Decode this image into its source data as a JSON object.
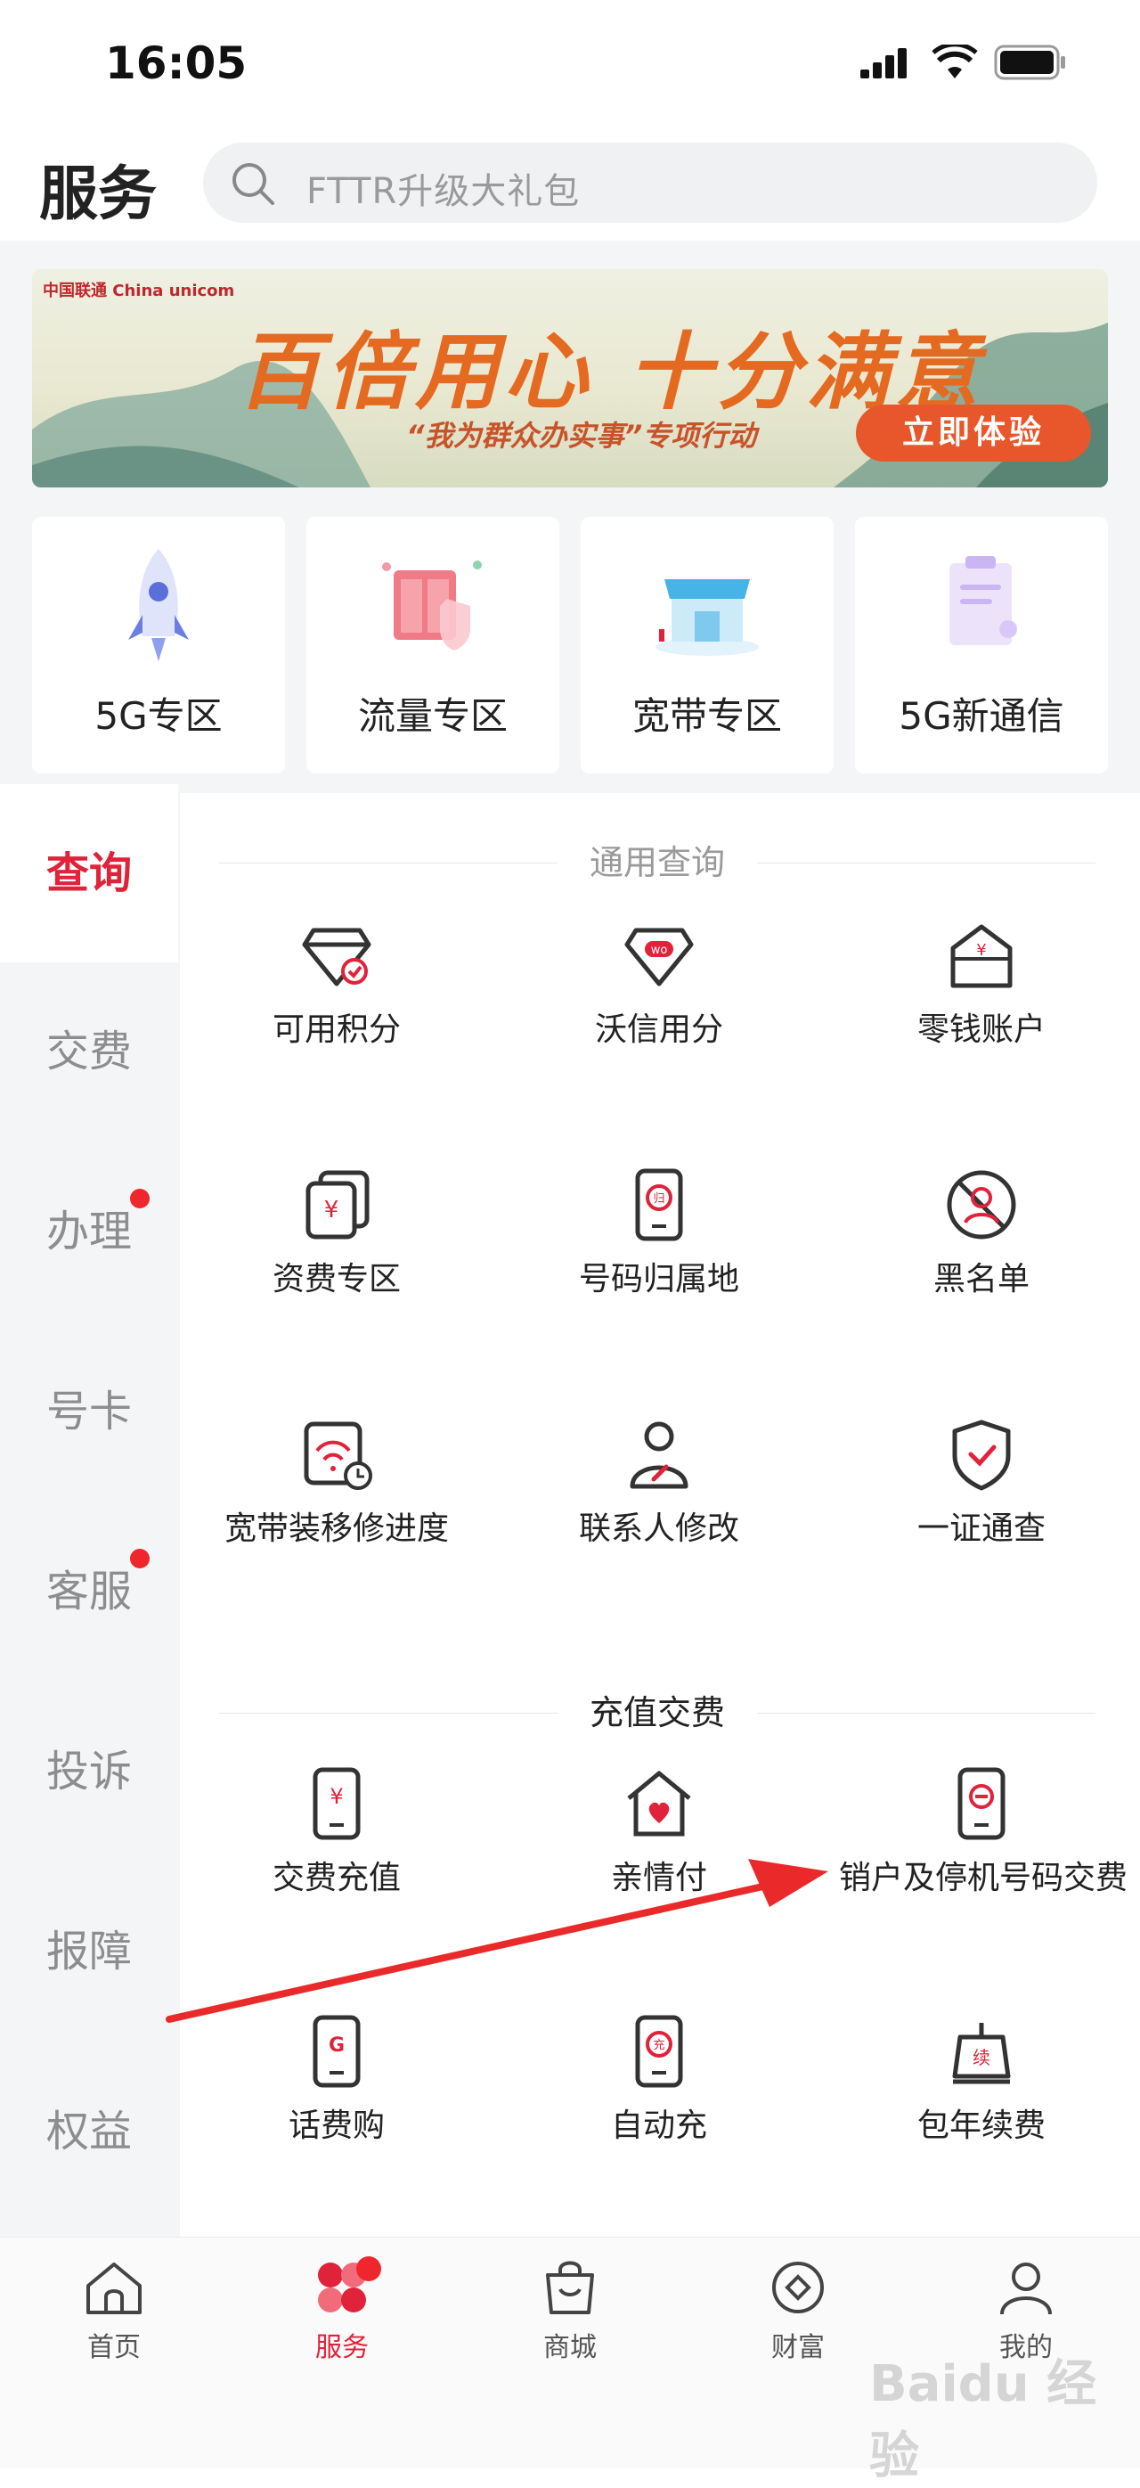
{
  "status_bar": {
    "time": "16:05"
  },
  "header": {
    "title": "服务",
    "search_placeholder": "FTTR升级大礼包"
  },
  "banner": {
    "brand": "中国联通 China unicom",
    "title": "百倍用心 十分满意",
    "subtitle": "“我为群众办实事”专项行动",
    "cta": "立即体验"
  },
  "zones": [
    {
      "label": "5G专区",
      "icon": "rocket-icon"
    },
    {
      "label": "流量专区",
      "icon": "shield-door-icon"
    },
    {
      "label": "宽带专区",
      "icon": "store-icon"
    },
    {
      "label": "5G新通信",
      "icon": "clipboard-icon"
    }
  ],
  "sidebar": {
    "items": [
      {
        "label": "查询",
        "active": true
      },
      {
        "label": "交费"
      },
      {
        "label": "办理",
        "badge": true
      },
      {
        "label": "号卡"
      },
      {
        "label": "客服",
        "badge": true
      },
      {
        "label": "投诉"
      },
      {
        "label": "报障"
      },
      {
        "label": "权益"
      }
    ]
  },
  "sections": [
    {
      "title": "通用查询",
      "items": [
        {
          "label": "可用积分",
          "icon": "points-gem-icon"
        },
        {
          "label": "沃信用分",
          "icon": "wo-gem-icon"
        },
        {
          "label": "零钱账户",
          "icon": "wallet-house-icon"
        },
        {
          "label": "资费专区",
          "icon": "tariff-cards-icon"
        },
        {
          "label": "号码归属地",
          "icon": "phone-location-icon"
        },
        {
          "label": "黑名单",
          "icon": "blacklist-icon"
        },
        {
          "label": "宽带装移修进度",
          "icon": "broadband-progress-icon"
        },
        {
          "label": "联系人修改",
          "icon": "contact-edit-icon"
        },
        {
          "label": "一证通查",
          "icon": "id-check-shield-icon"
        }
      ]
    },
    {
      "title": "充值交费",
      "items": [
        {
          "label": "交费充值",
          "icon": "phone-yuan-icon"
        },
        {
          "label": "亲情付",
          "icon": "heart-house-icon"
        },
        {
          "label": "销户及停机号码交费",
          "icon": "phone-minus-icon"
        },
        {
          "label": "话费购",
          "icon": "phone-g-icon"
        },
        {
          "label": "自动充",
          "icon": "auto-recharge-icon"
        },
        {
          "label": "包年续费",
          "icon": "annual-renew-icon"
        }
      ]
    }
  ],
  "tabbar": [
    {
      "label": "首页",
      "icon": "home-icon"
    },
    {
      "label": "服务",
      "icon": "service-icon",
      "active": true,
      "badge": true
    },
    {
      "label": "商城",
      "icon": "shopping-bag-icon"
    },
    {
      "label": "财富",
      "icon": "wealth-coin-icon"
    },
    {
      "label": "我的",
      "icon": "profile-icon"
    }
  ],
  "watermark": "Baidu 经验",
  "colors": {
    "accent": "#e0223a",
    "badge": "#f0262d",
    "background": "#f4f5f7"
  }
}
